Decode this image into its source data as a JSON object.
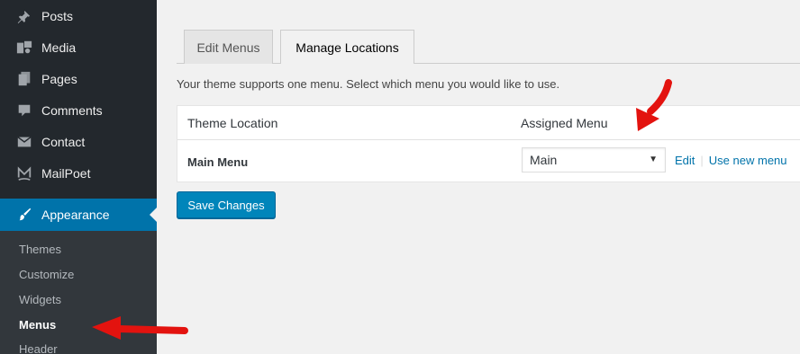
{
  "sidebar": {
    "items": [
      {
        "label": "Posts",
        "icon": "pin-icon"
      },
      {
        "label": "Media",
        "icon": "media-icon"
      },
      {
        "label": "Pages",
        "icon": "pages-icon"
      },
      {
        "label": "Comments",
        "icon": "comment-icon"
      },
      {
        "label": "Contact",
        "icon": "envelope-icon"
      },
      {
        "label": "MailPoet",
        "icon": "mailpoet-icon"
      },
      {
        "label": "Appearance",
        "icon": "brush-icon"
      }
    ],
    "submenu": [
      "Themes",
      "Customize",
      "Widgets",
      "Menus",
      "Header"
    ],
    "current_submenu": "Menus"
  },
  "tabs": {
    "edit_menus": "Edit Menus",
    "manage_locations": "Manage Locations"
  },
  "description": "Your theme supports one menu. Select which menu you would like to use.",
  "table": {
    "headers": [
      "Theme Location",
      "Assigned Menu"
    ],
    "row": {
      "location": "Main Menu",
      "selected_menu": "Main",
      "edit_link": "Edit",
      "use_new_link": "Use new menu"
    }
  },
  "save_button": "Save Changes",
  "colors": {
    "sidebar_bg": "#23282d",
    "submenu_bg": "#32373c",
    "accent": "#0073aa",
    "button": "#0085ba",
    "annotation_arrow": "#e3130f"
  }
}
